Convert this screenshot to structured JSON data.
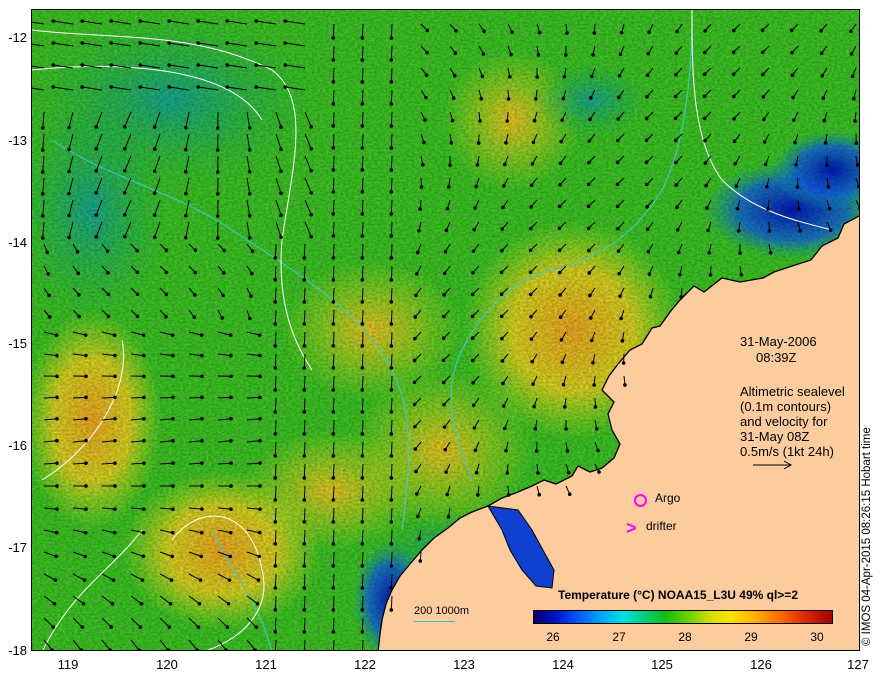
{
  "map": {
    "date": "31-May-2006",
    "time": "08:39Z",
    "altimetry_lines": [
      "Altimetric sealevel",
      "(0.1m contours)",
      "and velocity for",
      "31-May 08Z",
      "0.5m/s (1kt 24h)"
    ],
    "lat_labels": [
      "-12",
      "-13",
      "-14",
      "-15",
      "-16",
      "-17",
      "-18"
    ],
    "lon_labels": [
      "119",
      "120",
      "121",
      "122",
      "123",
      "124",
      "125",
      "126",
      "127"
    ],
    "lon_range": [
      118.6,
      127
    ],
    "lat_range": [
      -18,
      -11.7
    ],
    "colorbar": {
      "title": "Temperature (°C) NOAA15_L3U 49% ql>=2",
      "ticks": [
        "26",
        "27",
        "28",
        "29",
        "30"
      ],
      "range": [
        25.7,
        30.6
      ]
    },
    "scale_label": "200  1000m",
    "argo_label": "Argo",
    "drifter_label": "drifter",
    "drifter_symbol": ">",
    "credit": "© IMOS 04-Apr-2015 08:26:15 Hobart time",
    "colors": {
      "land": "#fdcc9e",
      "coast": "#000000",
      "isobath": "#40c8d0",
      "contour": "#ffffff",
      "marker": "#ff00ff",
      "arrow": "#000000"
    }
  }
}
